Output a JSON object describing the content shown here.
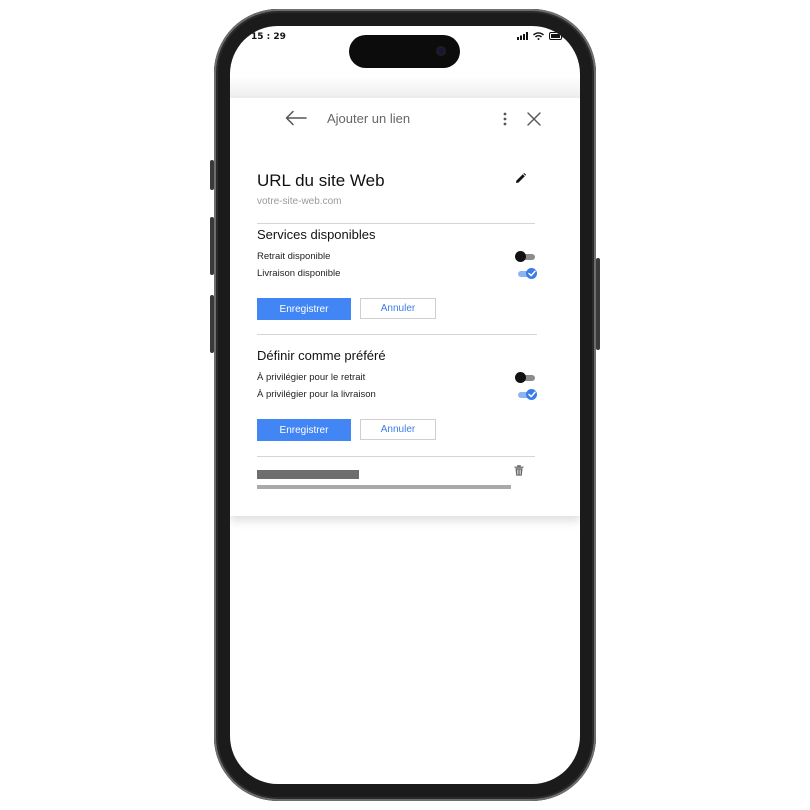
{
  "status_bar": {
    "time": "15 : 29"
  },
  "dialog": {
    "title": "Ajouter un lien",
    "back_icon": "arrow-left-icon",
    "more_icon": "vertical-dots-icon",
    "close_icon": "close-icon"
  },
  "url_section": {
    "heading": "URL du site Web",
    "placeholder": "votre-site-web.com",
    "edit_icon": "pencil-icon"
  },
  "services_section": {
    "heading": "Services disponibles",
    "options": [
      {
        "label": "Retrait disponible",
        "enabled": false
      },
      {
        "label": "Livraison disponible",
        "enabled": true
      }
    ],
    "save_label": "Enregistrer",
    "cancel_label": "Annuler"
  },
  "preferred_section": {
    "heading": "Définir comme préféré",
    "options": [
      {
        "label": "À privilégier pour le retrait",
        "enabled": false
      },
      {
        "label": "À privilégier pour la livraison",
        "enabled": true
      }
    ],
    "save_label": "Enregistrer",
    "cancel_label": "Annuler"
  },
  "placeholder_row": {
    "delete_icon": "trash-icon"
  },
  "colors": {
    "accent": "#4285f4",
    "toggle_on_track": "#8db4f1",
    "toggle_on_knob": "#3b7de8",
    "toggle_off_knob": "#111111",
    "toggle_off_track": "#8c8c8c"
  }
}
